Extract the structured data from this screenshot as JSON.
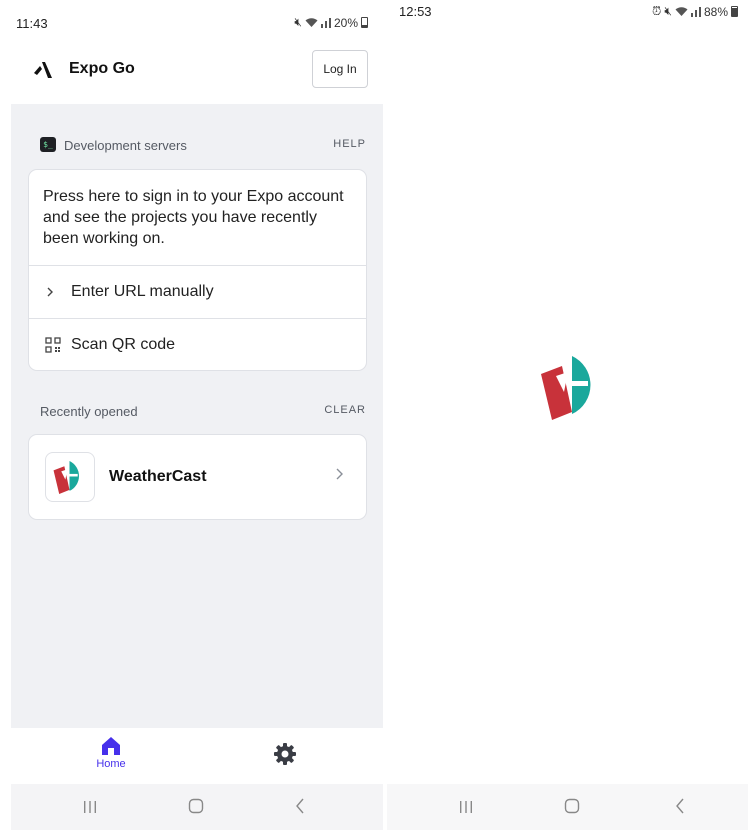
{
  "left_screen": {
    "status_bar": {
      "time": "11:43",
      "battery": "20%",
      "battery_level": 0.2
    },
    "app_bar": {
      "title": "Expo Go",
      "login_label": "Log In"
    },
    "dev_servers": {
      "heading": "Development servers",
      "help_label": "HELP",
      "signin_text": "Press here to sign in to your Expo account and see the projects you have recently been working on.",
      "enter_url_label": "Enter URL manually",
      "scan_qr_label": "Scan QR code"
    },
    "recently_opened": {
      "heading": "Recently opened",
      "clear_label": "CLEAR",
      "items": [
        {
          "name": "WeatherCast"
        }
      ]
    },
    "tab_bar": {
      "home_label": "Home",
      "accent": "#4630eb"
    }
  },
  "right_screen": {
    "status_bar": {
      "time": "12:53",
      "battery": "88%",
      "battery_level": 0.88
    }
  },
  "icons": {
    "expo_logo": "expo-logo-icon",
    "terminal": "terminal-icon",
    "chevron": "chevron-right-icon",
    "qr": "qr-code-icon",
    "home": "home-icon",
    "settings": "gear-icon",
    "app_logo": "weathercast-logo-icon"
  },
  "colors": {
    "logo_red": "#c8323a",
    "logo_teal": "#1aa89c",
    "content_bg": "#f0f1f4"
  }
}
